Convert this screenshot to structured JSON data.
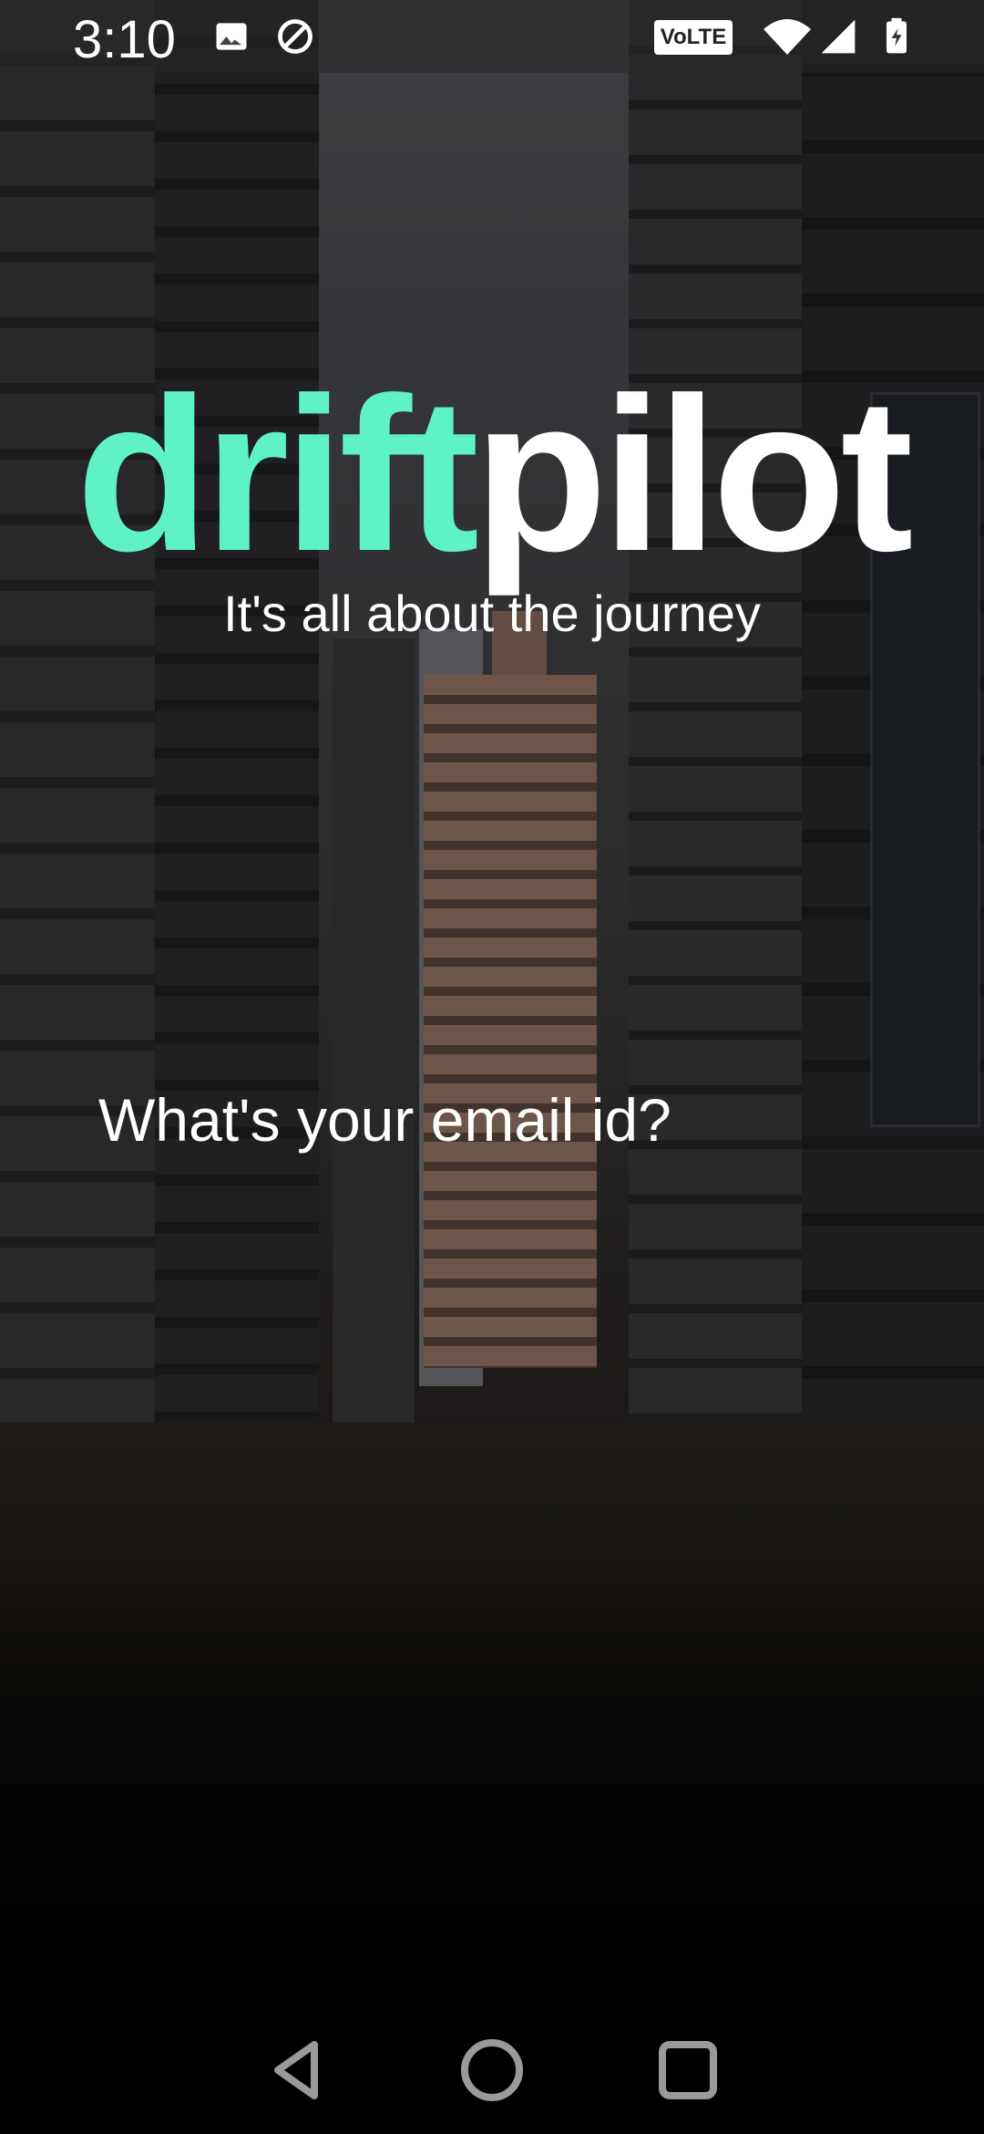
{
  "status_bar": {
    "time": "3:10",
    "left_icons": [
      "image-icon",
      "do-not-disturb-icon"
    ],
    "network_badge": "VoLTE",
    "right_icons": [
      "wifi-icon",
      "signal-icon",
      "battery-icon"
    ]
  },
  "brand": {
    "name_part1": "drift",
    "name_part2": "pilot",
    "accent_color": "#5ef2c4",
    "tagline": "It's all about the journey"
  },
  "prompt": {
    "question": "What's your email id?"
  },
  "nav_bar": {
    "buttons": [
      "back-icon",
      "home-icon",
      "recents-icon"
    ]
  }
}
